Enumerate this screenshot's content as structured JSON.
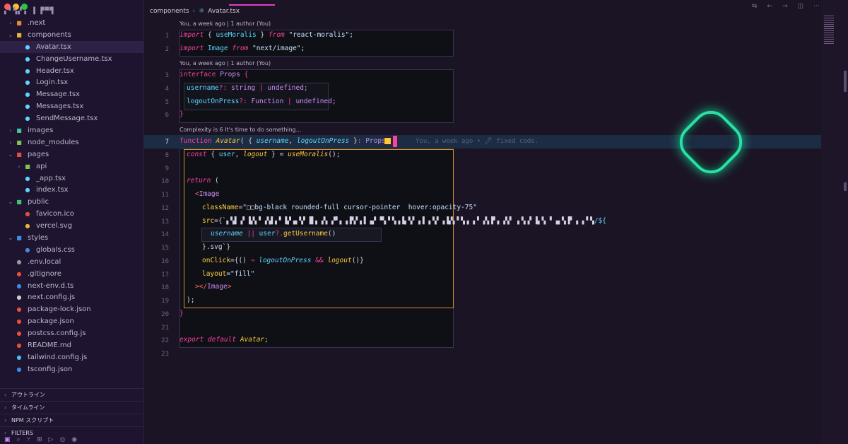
{
  "project": "▖▘▚▞▗ ▐ ▛▀▜",
  "tree": [
    {
      "label": ".next",
      "type": "dir",
      "depth": 0,
      "open": false,
      "icon": "folder-next-icon",
      "color": "#e58a3c"
    },
    {
      "label": "components",
      "type": "dir",
      "depth": 0,
      "open": true,
      "icon": "folder-components-icon",
      "color": "#e5b53c"
    },
    {
      "label": "Avatar.tsx",
      "type": "file",
      "depth": 1,
      "icon": "react-icon",
      "color": "#5fd4ff",
      "active": true
    },
    {
      "label": "ChangeUsername.tsx",
      "type": "file",
      "depth": 1,
      "icon": "react-icon",
      "color": "#5fd4ff"
    },
    {
      "label": "Header.tsx",
      "type": "file",
      "depth": 1,
      "icon": "react-icon",
      "color": "#5fd4ff"
    },
    {
      "label": "Login.tsx",
      "type": "file",
      "depth": 1,
      "icon": "react-icon",
      "color": "#5fd4ff"
    },
    {
      "label": "Message.tsx",
      "type": "file",
      "depth": 1,
      "icon": "react-icon",
      "color": "#5fd4ff"
    },
    {
      "label": "Messages.tsx",
      "type": "file",
      "depth": 1,
      "icon": "react-icon",
      "color": "#5fd4ff"
    },
    {
      "label": "SendMessage.tsx",
      "type": "file",
      "depth": 1,
      "icon": "react-icon",
      "color": "#5fd4ff"
    },
    {
      "label": "images",
      "type": "dir",
      "depth": 0,
      "open": false,
      "icon": "folder-images-icon",
      "color": "#3cc6a0"
    },
    {
      "label": "node_modules",
      "type": "dir",
      "depth": 0,
      "open": false,
      "icon": "folder-node-icon",
      "color": "#7cc44a"
    },
    {
      "label": "pages",
      "type": "dir",
      "depth": 0,
      "open": true,
      "icon": "folder-pages-icon",
      "color": "#e5503c"
    },
    {
      "label": "api",
      "type": "dir",
      "depth": 1,
      "open": false,
      "icon": "folder-api-icon",
      "color": "#7cc44a"
    },
    {
      "label": "_app.tsx",
      "type": "file",
      "depth": 1,
      "icon": "react-icon",
      "color": "#5fd4ff"
    },
    {
      "label": "index.tsx",
      "type": "file",
      "depth": 1,
      "icon": "react-icon",
      "color": "#5fd4ff"
    },
    {
      "label": "public",
      "type": "dir",
      "depth": 0,
      "open": true,
      "icon": "folder-public-icon",
      "color": "#3cc66e"
    },
    {
      "label": "favicon.ico",
      "type": "file",
      "depth": 1,
      "icon": "favicon-icon",
      "color": "#e5503c"
    },
    {
      "label": "vercel.svg",
      "type": "file",
      "depth": 1,
      "icon": "svg-icon",
      "color": "#e5b53c"
    },
    {
      "label": "styles",
      "type": "dir",
      "depth": 0,
      "open": true,
      "icon": "folder-styles-icon",
      "color": "#3c8ce5"
    },
    {
      "label": "globals.css",
      "type": "file",
      "depth": 1,
      "icon": "css-icon",
      "color": "#3c8ce5"
    },
    {
      "label": ".env.local",
      "type": "file",
      "depth": 0,
      "icon": "gear-icon",
      "color": "#9a9a9a"
    },
    {
      "label": ".gitignore",
      "type": "file",
      "depth": 0,
      "icon": "git-icon",
      "color": "#e5503c"
    },
    {
      "label": "next-env.d.ts",
      "type": "file",
      "depth": 0,
      "icon": "typescript-icon",
      "color": "#3c8ce5"
    },
    {
      "label": "next.config.js",
      "type": "file",
      "depth": 0,
      "icon": "next-icon",
      "color": "#cccccc"
    },
    {
      "label": "package-lock.json",
      "type": "file",
      "depth": 0,
      "icon": "npm-icon",
      "color": "#e5503c"
    },
    {
      "label": "package.json",
      "type": "file",
      "depth": 0,
      "icon": "npm-icon",
      "color": "#e5503c"
    },
    {
      "label": "postcss.config.js",
      "type": "file",
      "depth": 0,
      "icon": "postcss-icon",
      "color": "#e5503c"
    },
    {
      "label": "README.md",
      "type": "file",
      "depth": 0,
      "icon": "markdown-icon",
      "color": "#e5503c"
    },
    {
      "label": "tailwind.config.js",
      "type": "file",
      "depth": 0,
      "icon": "tailwind-icon",
      "color": "#3cc6e5"
    },
    {
      "label": "tsconfig.json",
      "type": "file",
      "depth": 0,
      "icon": "tsconfig-icon",
      "color": "#3c8ce5"
    }
  ],
  "panels": [
    "アウトライン",
    "タイムライン",
    "NPM スクリプト",
    "FILTERS"
  ],
  "breadcrumb": [
    "components",
    "Avatar.tsx"
  ],
  "codelens": [
    "You, a week ago | 1 author (You)",
    "You, a week ago | 1 author (You)",
    "Complexity is 6 It's time to do something..."
  ],
  "line_numbers": [
    "1",
    "2",
    "3",
    "4",
    "5",
    "6",
    "7",
    "8",
    "9",
    "10",
    "11",
    "12",
    "13",
    "14",
    "15",
    "16",
    "17",
    "18",
    "19",
    "20",
    "21",
    "22",
    "23"
  ],
  "current_line": "7",
  "blame": "You, a week ago • 🖊 fixed code.",
  "code": {
    "l1": [
      [
        "import",
        "kw"
      ],
      [
        " { ",
        "pun"
      ],
      [
        "useMoralis",
        "id"
      ],
      [
        " } ",
        "pun"
      ],
      [
        "from",
        "kw"
      ],
      [
        " \"react-moralis\";",
        "str"
      ]
    ],
    "l2": [
      [
        "import",
        "kw"
      ],
      [
        " Image ",
        "id"
      ],
      [
        "from",
        "kw"
      ],
      [
        " \"next/image\";",
        "str"
      ]
    ],
    "l3": [
      [
        "interface",
        "kw2"
      ],
      [
        " Props ",
        "ty"
      ],
      [
        "{",
        "kw2"
      ]
    ],
    "l4": [
      [
        "username",
        "id"
      ],
      [
        "?:",
        "kw2"
      ],
      [
        " string ",
        "ty"
      ],
      [
        "| ",
        "kw2"
      ],
      [
        "undefined;",
        "ty"
      ]
    ],
    "l5": [
      [
        "logoutOnPress",
        "id"
      ],
      [
        "?:",
        "kw2"
      ],
      [
        " Function ",
        "ty"
      ],
      [
        "| ",
        "kw2"
      ],
      [
        "undefined;",
        "ty"
      ]
    ],
    "l6": [
      [
        "}",
        "kw2"
      ]
    ],
    "l7": [
      [
        "function",
        "kw2"
      ],
      [
        " Avatar",
        "fn"
      ],
      [
        "( { ",
        "pun"
      ],
      [
        "username",
        "prm"
      ],
      [
        ", ",
        "pun"
      ],
      [
        "logoutOnPress",
        "prm"
      ],
      [
        " }",
        "pun"
      ],
      [
        ": ",
        "kw2"
      ],
      [
        "Props",
        "ty"
      ],
      [
        ") {",
        "pun"
      ]
    ],
    "l8": [
      [
        "const",
        "kw"
      ],
      [
        " { ",
        "pun"
      ],
      [
        "user",
        "id"
      ],
      [
        ", ",
        "pun"
      ],
      [
        "logout",
        "fn"
      ],
      [
        " } = ",
        "pun"
      ],
      [
        "useMoralis",
        "fn"
      ],
      [
        "();",
        "pun"
      ]
    ],
    "l9": [],
    "l10": [
      [
        "return",
        "kw"
      ],
      [
        " (",
        "pun"
      ]
    ],
    "l11": [
      [
        "<",
        "tag"
      ],
      [
        "Image",
        "ty"
      ]
    ],
    "l12": [
      [
        "className",
        "attr"
      ],
      [
        "=\"",
        "pun"
      ],
      [
        "□▢",
        "pun"
      ],
      [
        "bg-black rounded-full cursor-pointer  hover:opacity-75\"",
        "str"
      ]
    ],
    "l13": [
      [
        "src",
        "attr"
      ],
      [
        "={`",
        "pun"
      ],
      [
        "▖▚▌▗▘▐▞▖▘▗▚▌▖▘▐▞▗▖▚▘▐▌▖▗▚ ▞▘▖▗▐▚▘▖▌▗▞ ▀▖▘▚▗▐▖▚▘▗▐ ▖▚▘▗▐▞▖▘▚▗ ▖▘▗▚▐▘▖▗▚▘ ▖▚▗▘▐▖▚ ▘▗▖▚▐▘▗ ▖▘▚",
        "pun"
      ],
      [
        "/${",
        "id"
      ]
    ],
    "l14": [
      [
        "username",
        "prm"
      ],
      [
        " || ",
        "kw2"
      ],
      [
        "user",
        "id"
      ],
      [
        "?.",
        "kw2"
      ],
      [
        "getUsername",
        "fn2"
      ],
      [
        "()",
        "pun"
      ]
    ],
    "l15": [
      [
        "}.svg`}",
        "pun"
      ]
    ],
    "l16": [
      [
        "onClick",
        "attr"
      ],
      [
        "={() ",
        "pun"
      ],
      [
        "⇒",
        "kw2"
      ],
      [
        " logoutOnPress",
        "prm"
      ],
      [
        " && ",
        "kw2"
      ],
      [
        "logout",
        "fn"
      ],
      [
        "()}",
        "pun"
      ]
    ],
    "l17": [
      [
        "layout",
        "attr"
      ],
      [
        "=\"fill\"",
        "str"
      ]
    ],
    "l18": [
      [
        "></",
        "tag"
      ],
      [
        "Image",
        "ty"
      ],
      [
        ">",
        "tag"
      ]
    ],
    "l19": [
      [
        ");",
        "pun"
      ]
    ],
    "l20": [
      [
        "}",
        "kw2"
      ]
    ],
    "l21": [],
    "l22": [
      [
        "export",
        "kw"
      ],
      [
        " default",
        "kw"
      ],
      [
        " Avatar",
        "fn"
      ],
      [
        ";",
        "pun"
      ]
    ],
    "l23": []
  }
}
